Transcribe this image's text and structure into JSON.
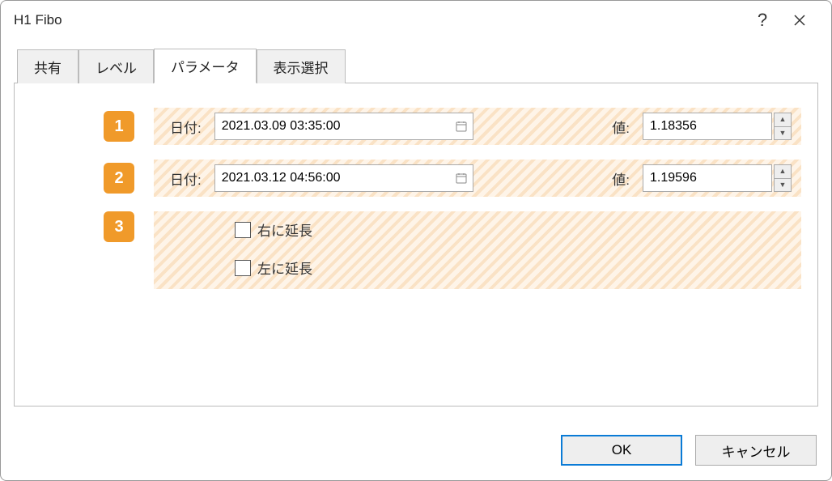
{
  "title": "H1 Fibo",
  "tabs": {
    "t0": "共有",
    "t1": "レベル",
    "t2": "パラメータ",
    "t3": "表示選択"
  },
  "rows": {
    "r1": {
      "badge": "1",
      "date_label": "日付:",
      "date_value": "2021.03.09 03:35:00",
      "value_label": "値:",
      "value_value": "1.18356"
    },
    "r2": {
      "badge": "2",
      "date_label": "日付:",
      "date_value": "2021.03.12 04:56:00",
      "value_label": "値:",
      "value_value": "1.19596"
    },
    "r3": {
      "badge": "3",
      "extend_right": "右に延長",
      "extend_left": "左に延長"
    }
  },
  "buttons": {
    "ok": "OK",
    "cancel": "キャンセル"
  }
}
